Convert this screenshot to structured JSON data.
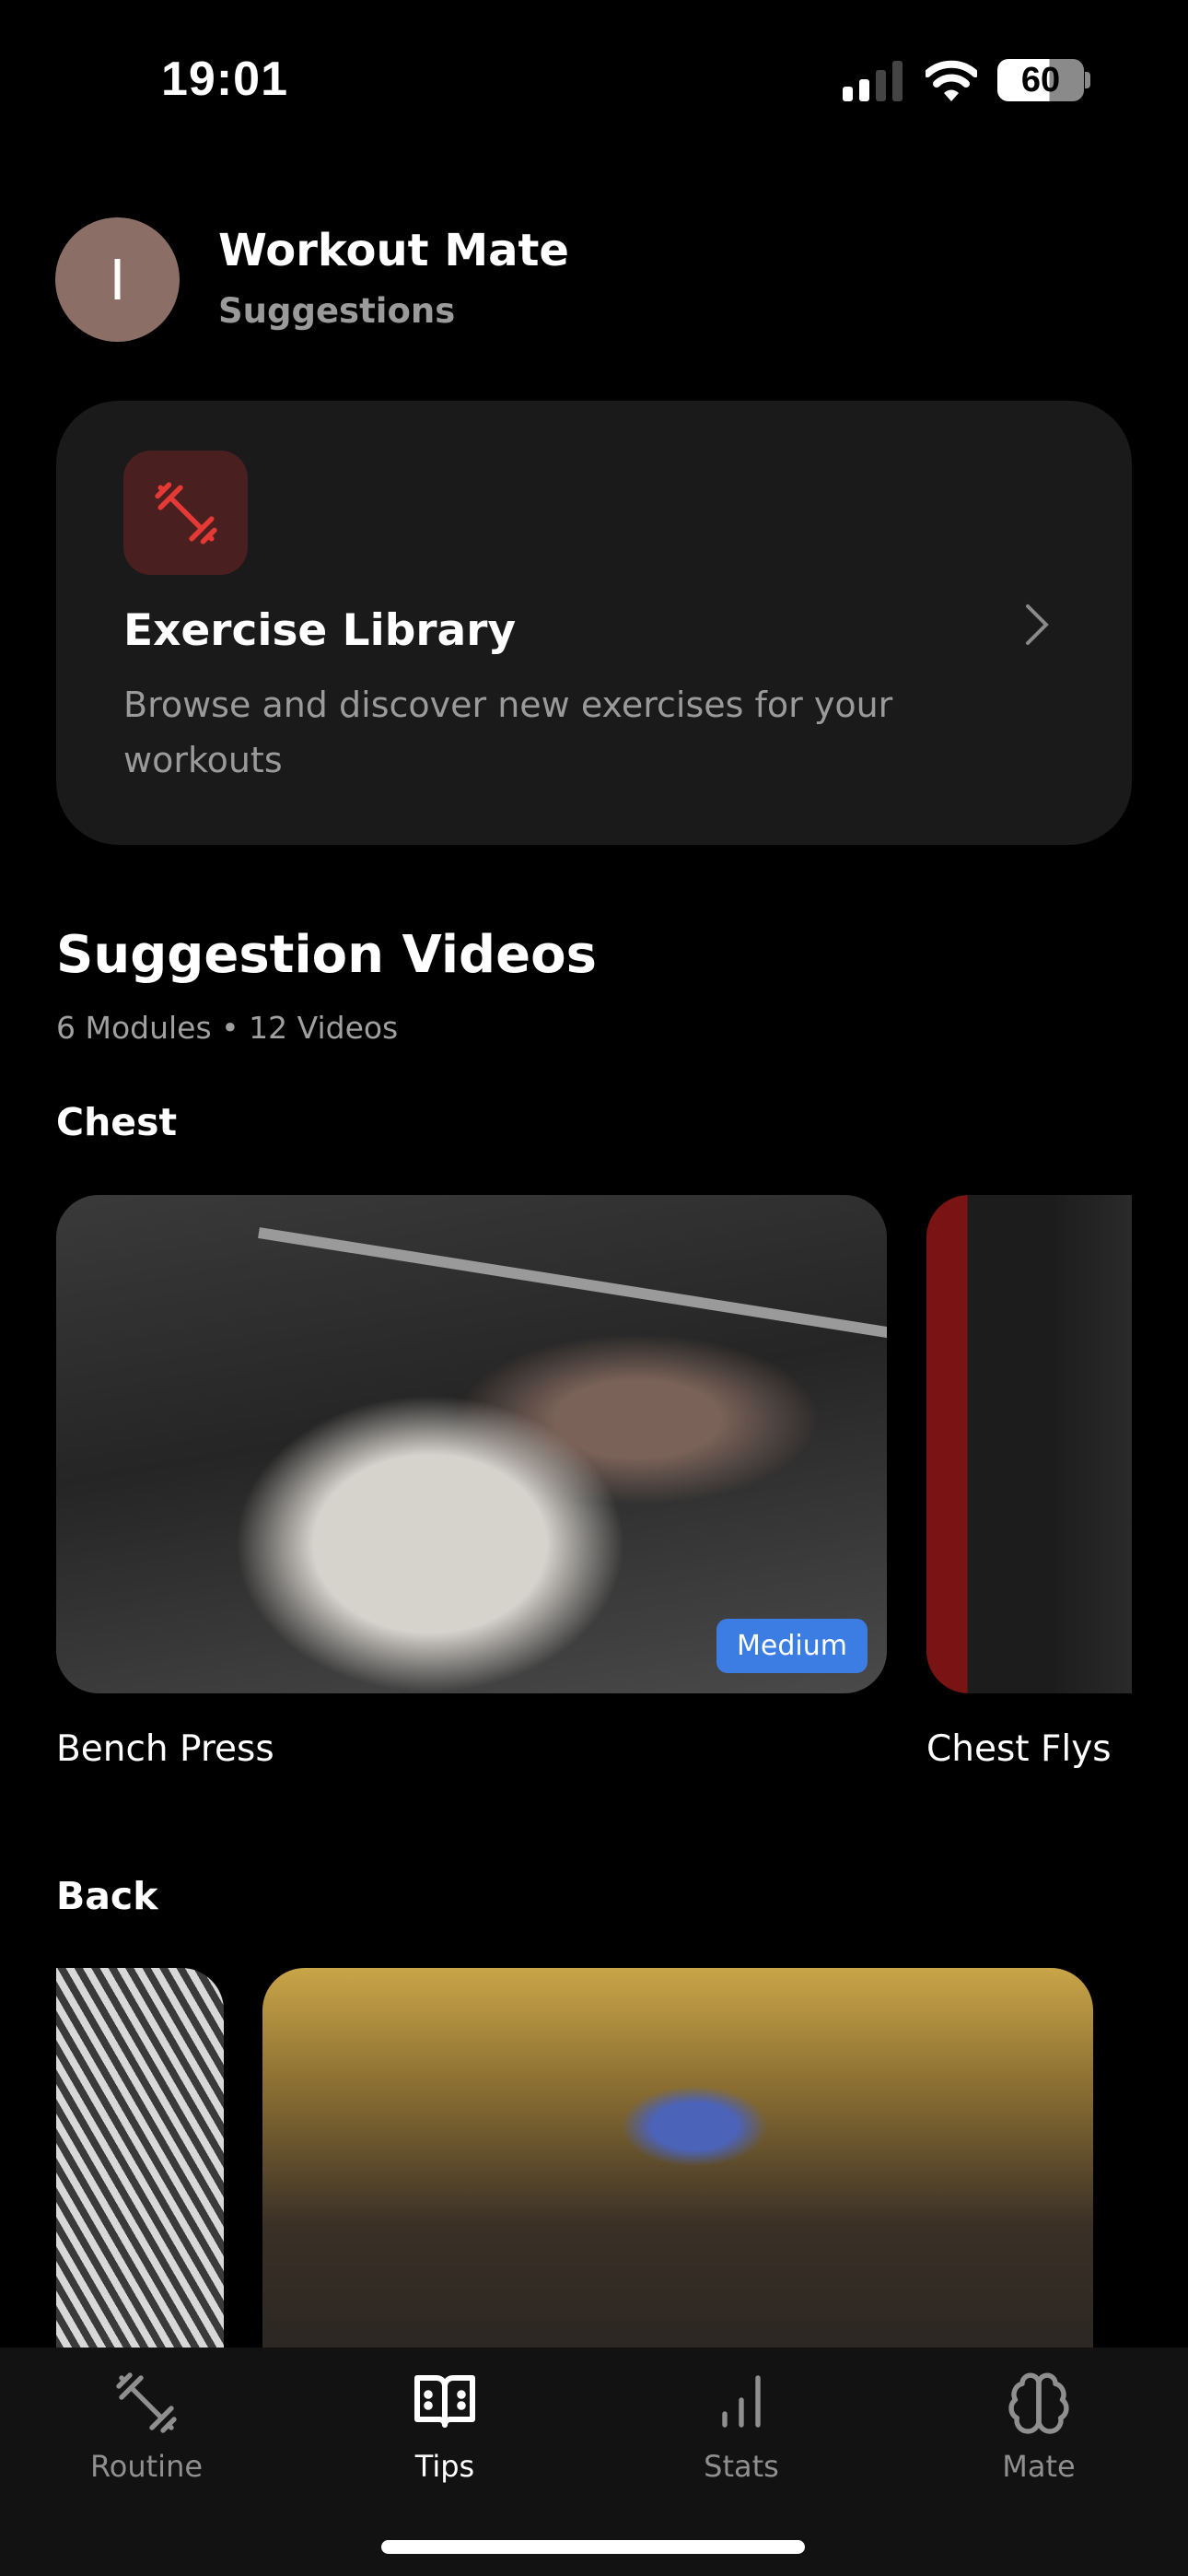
{
  "status_bar": {
    "time": "19:01",
    "battery": "60",
    "signal_icon": "cellular-signal-icon",
    "wifi_icon": "wifi-icon"
  },
  "header": {
    "avatar_initial": "I",
    "avatar_color": "#8b6f66",
    "title": "Workout Mate",
    "subtitle": "Suggestions"
  },
  "library_card": {
    "icon": "dumbbell-icon",
    "title": "Exercise Library",
    "description": "Browse and discover new exercises for your workouts",
    "accent": "#e53935"
  },
  "videos": {
    "title": "Suggestion Videos",
    "meta": "6 Modules • 12 Videos",
    "modules": [
      {
        "name": "Chest",
        "videos": [
          {
            "title": "Bench Press",
            "difficulty": "Medium"
          },
          {
            "title": "Chest Flys"
          }
        ]
      },
      {
        "name": "Back"
      }
    ],
    "badge_color": "#3b7de2"
  },
  "tabs": [
    {
      "label": "Routine",
      "icon": "dumbbell-icon",
      "active": false
    },
    {
      "label": "Tips",
      "icon": "book-open-icon",
      "active": true
    },
    {
      "label": "Stats",
      "icon": "bar-chart-icon",
      "active": false
    },
    {
      "label": "Mate",
      "icon": "brain-icon",
      "active": false
    }
  ]
}
